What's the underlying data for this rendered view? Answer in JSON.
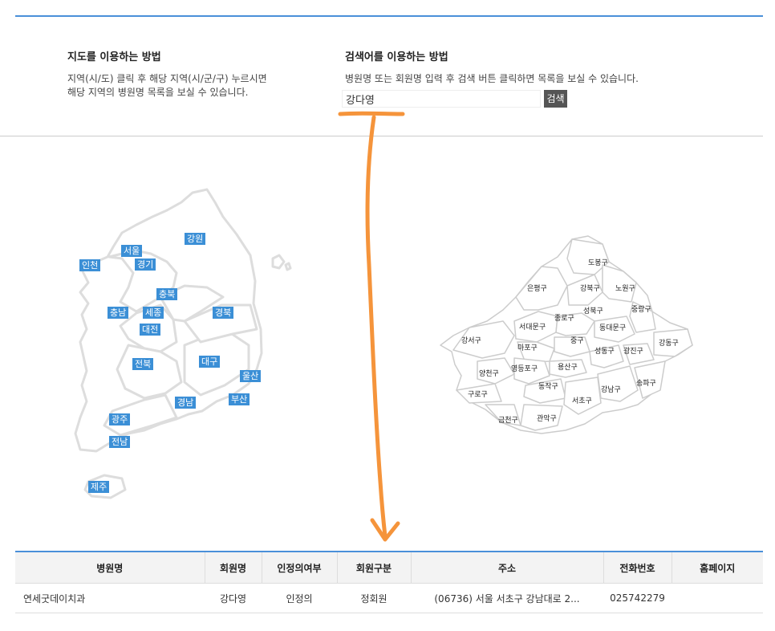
{
  "guide": {
    "map_title": "지도를 이용하는 방법",
    "map_desc_line1": "지역(시/도) 클릭 후 해당 지역(시/군/구) 누르시면",
    "map_desc_line2": "해당 지역의 병원명 목록을 보실 수 있습니다.",
    "search_title": "검색어를 이용하는 방법",
    "search_desc": "병원명 또는 회원명 입력 후 검색 버튼 클릭하면 목록을 보실 수 있습니다."
  },
  "search": {
    "value": "강다영",
    "button_label": "검색"
  },
  "korea_regions": [
    {
      "name": "서울"
    },
    {
      "name": "강원"
    },
    {
      "name": "인천"
    },
    {
      "name": "경기"
    },
    {
      "name": "충북"
    },
    {
      "name": "충남"
    },
    {
      "name": "세종"
    },
    {
      "name": "경북"
    },
    {
      "name": "대전"
    },
    {
      "name": "전북"
    },
    {
      "name": "대구"
    },
    {
      "name": "울산"
    },
    {
      "name": "부산"
    },
    {
      "name": "경남"
    },
    {
      "name": "광주"
    },
    {
      "name": "전남"
    },
    {
      "name": "제주"
    }
  ],
  "seoul_districts": [
    "도봉구",
    "은평구",
    "강북구",
    "노원구",
    "성북구",
    "중랑구",
    "종로구",
    "서대문구",
    "동대문구",
    "강서구",
    "중구",
    "마포구",
    "성동구",
    "광진구",
    "강동구",
    "양천구",
    "영등포구",
    "용산구",
    "동작구",
    "강남구",
    "송파구",
    "구로구",
    "서초구",
    "금천구",
    "관악구"
  ],
  "table": {
    "headers": [
      "병원명",
      "회원명",
      "인정의여부",
      "회원구분",
      "주소",
      "전화번호",
      "홈페이지"
    ],
    "rows": [
      {
        "hospital": "연세굿데이치과",
        "member": "강다영",
        "certified": "인정의",
        "member_type": "정회원",
        "address": "(06736) 서울 서초구 강남대로 2...",
        "phone": "025742279",
        "homepage": ""
      }
    ]
  },
  "colors": {
    "accent": "#4a90d9",
    "region_label": "#3b8fd6",
    "annotation": "#f5943b"
  }
}
